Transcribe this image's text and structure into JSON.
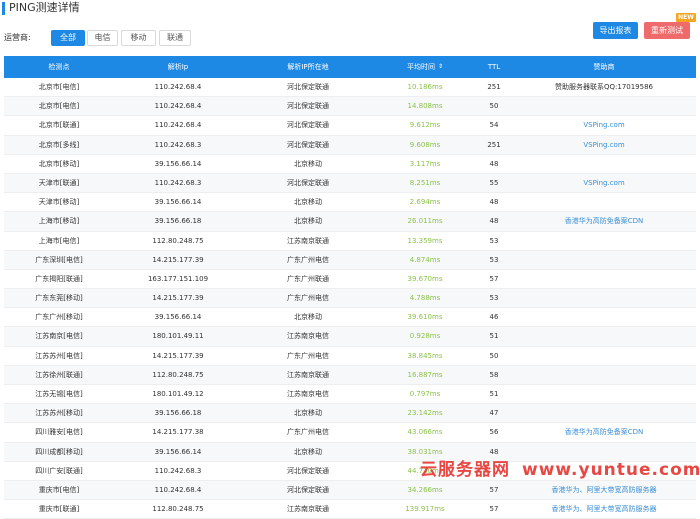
{
  "title": "PING测速详情",
  "carrier_label": "运营商:",
  "carriers": [
    "全部",
    "电信",
    "移动",
    "联通"
  ],
  "buttons": {
    "export": "导出报表",
    "retest": "重新测试",
    "new_badge": "NEW"
  },
  "colors": {
    "accent": "#1e88e5",
    "retest": "#ef6a6a",
    "time": "#8bc34a",
    "sponsor_link": "#3b8fd6",
    "watermark": "#e53935"
  },
  "table": {
    "headers": [
      "检测点",
      "解析Ip",
      "解析IP所在地",
      "平均时间",
      "TTL",
      "赞助商"
    ],
    "sort_icon": "⇕",
    "rows": [
      [
        "北京市[电信]",
        "110.242.68.4",
        "河北保定联通",
        "10.186ms",
        "251",
        "赞助服务器联系QQ:17019586"
      ],
      [
        "北京市[电信]",
        "110.242.68.4",
        "河北保定联通",
        "14.808ms",
        "50",
        ""
      ],
      [
        "北京市[联通]",
        "110.242.68.4",
        "河北保定联通",
        "9.612ms",
        "54",
        "VSPing.com"
      ],
      [
        "北京市[多线]",
        "110.242.68.3",
        "河北保定联通",
        "9.608ms",
        "251",
        "VSPing.com"
      ],
      [
        "北京市[移动]",
        "39.156.66.14",
        "北京移动",
        "3.117ms",
        "48",
        ""
      ],
      [
        "天津市[联通]",
        "110.242.68.3",
        "河北保定联通",
        "8.251ms",
        "55",
        "VSPing.com"
      ],
      [
        "天津市[移动]",
        "39.156.66.14",
        "北京移动",
        "2.694ms",
        "48",
        ""
      ],
      [
        "上海市[移动]",
        "39.156.66.18",
        "北京移动",
        "26.011ms",
        "48",
        "香港华为高防免备案CDN"
      ],
      [
        "上海市[电信]",
        "112.80.248.75",
        "江苏南京联通",
        "13.359ms",
        "53",
        ""
      ],
      [
        "广东深圳[电信]",
        "14.215.177.39",
        "广东广州电信",
        "4.874ms",
        "53",
        ""
      ],
      [
        "广东揭阳[联通]",
        "163.177.151.109",
        "广东广州联通",
        "39.670ms",
        "57",
        ""
      ],
      [
        "广东东莞[移动]",
        "14.215.177.39",
        "广东广州电信",
        "4.788ms",
        "53",
        ""
      ],
      [
        "广东广州[移动]",
        "39.156.66.14",
        "北京移动",
        "39.610ms",
        "46",
        ""
      ],
      [
        "江苏南京[电信]",
        "180.101.49.11",
        "江苏南京电信",
        "0.928ms",
        "51",
        ""
      ],
      [
        "江苏苏州[电信]",
        "14.215.177.39",
        "广东广州电信",
        "38.845ms",
        "50",
        ""
      ],
      [
        "江苏徐州[联通]",
        "112.80.248.75",
        "江苏南京联通",
        "16.887ms",
        "58",
        ""
      ],
      [
        "江苏无锡[电信]",
        "180.101.49.12",
        "江苏南京电信",
        "0.797ms",
        "51",
        ""
      ],
      [
        "江苏苏州[移动]",
        "39.156.66.18",
        "北京移动",
        "23.142ms",
        "47",
        ""
      ],
      [
        "四川雅安[电信]",
        "14.215.177.38",
        "广东广州电信",
        "43.066ms",
        "56",
        "香港华为高防免备案CDN"
      ],
      [
        "四川成都[移动]",
        "39.156.66.14",
        "北京移动",
        "38.031ms",
        "48",
        ""
      ],
      [
        "四川广安[联通]",
        "110.242.68.3",
        "河北保定联通",
        "44.730ms",
        "",
        ""
      ],
      [
        "重庆市[电信]",
        "110.242.68.4",
        "河北保定联通",
        "34.266ms",
        "57",
        "香港华为、阿里大带宽高防服务器"
      ],
      [
        "重庆市[联通]",
        "112.80.248.75",
        "江苏南京联通",
        "139.917ms",
        "57",
        "香港华为、阿里大带宽高防服务器"
      ]
    ]
  },
  "watermark": {
    "brand": "云服务器网",
    "url": "www.yuntue.com"
  }
}
